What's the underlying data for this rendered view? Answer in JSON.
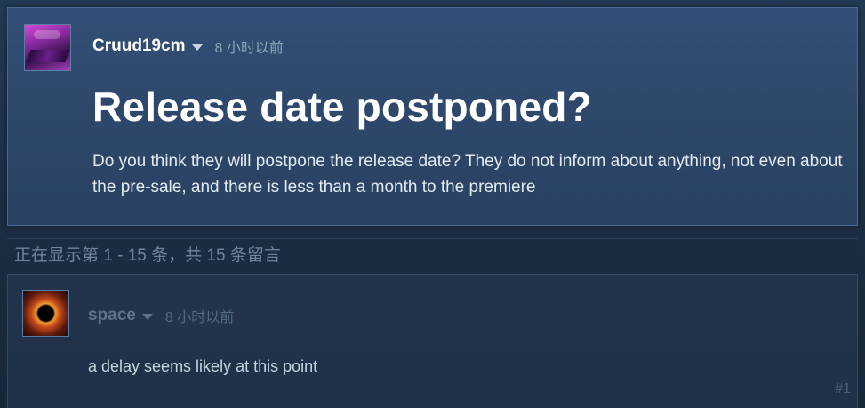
{
  "original_post": {
    "author": "Cruud19cm",
    "timestamp": "8 小时以前",
    "title": "Release date postponed?",
    "body": "Do you think they will postpone the release date? They do not inform about anything, not even about the pre-sale, and there is less than a month to the premiere",
    "avatar_icon": "user-avatar"
  },
  "paging": {
    "text": "正在显示第 1 - 15 条，共 15 条留言"
  },
  "comments": [
    {
      "author": "space",
      "timestamp": "8 小时以前",
      "body": "a delay seems likely at this point",
      "number": "#1",
      "avatar_icon": "user-avatar"
    }
  ],
  "colors": {
    "page_background": "#1b2838",
    "card_background": "#2d4769",
    "title_text": "#ffffff",
    "muted_text": "#8da3b8"
  },
  "icons": {
    "author_menu": "chevron-down-icon"
  }
}
